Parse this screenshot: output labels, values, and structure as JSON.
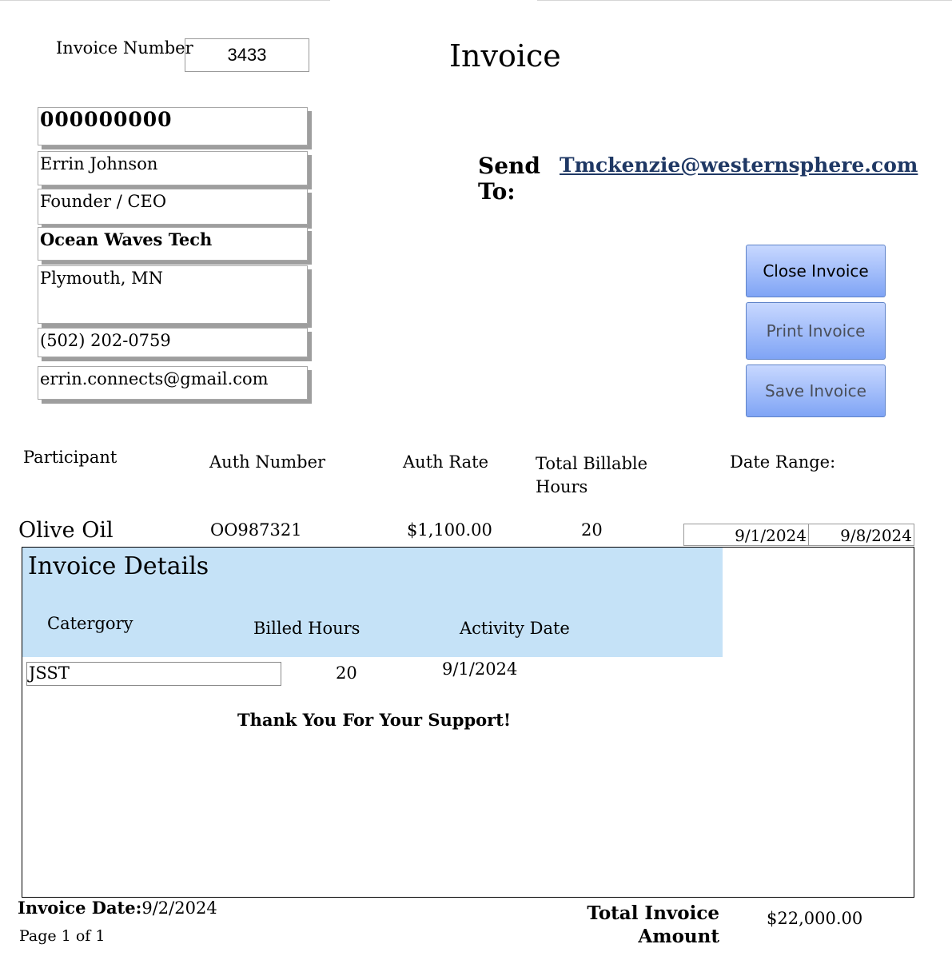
{
  "header": {
    "invoice_number_label": "Invoice Number",
    "invoice_number": "3433",
    "title": "Invoice"
  },
  "sender": {
    "id": "000000000",
    "name": "Errin Johnson",
    "title": "Founder / CEO",
    "company": "Ocean Waves Tech",
    "location": "Plymouth, MN",
    "phone": "(502) 202-0759",
    "email": "errin.connects@gmail.com"
  },
  "send_to": {
    "label_line1": "Send",
    "label_line2": "To:",
    "email": "Tmckenzie@westernsphere.com"
  },
  "buttons": {
    "close": "Close Invoice",
    "print": "Print Invoice",
    "save": "Save Invoice"
  },
  "columns": {
    "participant": "Participant",
    "auth_number": "Auth Number",
    "auth_rate": "Auth Rate",
    "total_billable_line1": "Total Billable",
    "total_billable_line2": "Hours",
    "date_range": "Date Range:"
  },
  "record": {
    "participant": "Olive Oil",
    "auth_number": "OO987321",
    "auth_rate": "$1,100.00",
    "total_hours": "20",
    "date_start": "9/1/2024",
    "date_end": "9/8/2024"
  },
  "details": {
    "title": "Invoice Details",
    "col_category": "Catergory",
    "col_hours": "Billed Hours",
    "col_activity_date": "Activity Date",
    "rows": [
      {
        "category": "JSST",
        "hours": "20",
        "activity_date": "9/1/2024"
      }
    ],
    "thank_you": "Thank You For Your Support!"
  },
  "footer": {
    "invoice_date_label": "Invoice Date:",
    "invoice_date": "9/2/2024",
    "page": "Page 1 of 1",
    "total_label_line1": "Total Invoice",
    "total_label_line2": "Amount",
    "total_amount": "$22,000.00"
  },
  "colors": {
    "details_header": "#c5e2f7",
    "button_top": "#c8d8ff",
    "button_bottom": "#7fa4f5",
    "link": "#1f3864"
  }
}
